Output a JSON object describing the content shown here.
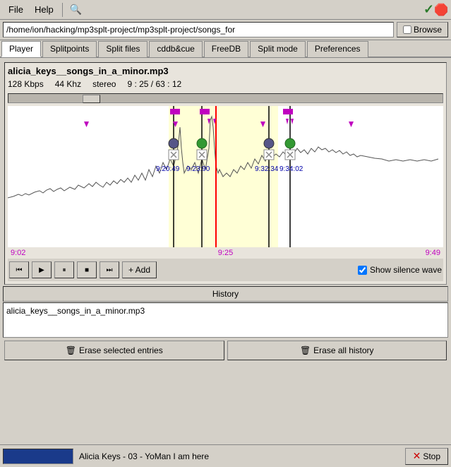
{
  "menubar": {
    "file": "File",
    "help": "Help",
    "search_icon": "🔍",
    "check_icon": "✓",
    "stop_icon": "🛑"
  },
  "pathbar": {
    "path": "/home/ion/hacking/mp3splt-project/mp3splt-project/songs_for",
    "browse_label": "Browse"
  },
  "tabs": [
    {
      "id": "player",
      "label": "Player",
      "active": true
    },
    {
      "id": "splitpoints",
      "label": "Splitpoints"
    },
    {
      "id": "split-files",
      "label": "Split files"
    },
    {
      "id": "cddb",
      "label": "cddb&cue"
    },
    {
      "id": "freedb",
      "label": "FreeDB"
    },
    {
      "id": "split-mode",
      "label": "Split mode"
    },
    {
      "id": "preferences",
      "label": "Preferences"
    }
  ],
  "player": {
    "filename": "alicia_keys__songs_in_a_minor.mp3",
    "bitrate": "128 Kbps",
    "sample_rate": "44 Khz",
    "channels": "stereo",
    "time_display": "9 : 25 / 63 : 12"
  },
  "waveform": {
    "time_start": "9:02",
    "time_mid": "9:25",
    "time_end": "9:49",
    "marker_times": [
      "9:20:49",
      "9:23:90",
      "9:32:34",
      "9:34:02"
    ],
    "playback_time": "9:25"
  },
  "transport": {
    "rewind_label": "⏮",
    "play_label": "▶",
    "pause_label": "⏸",
    "stop_label": "■",
    "forward_label": "⏭",
    "add_label": "+ Add",
    "show_silence_label": "Show silence wave"
  },
  "history": {
    "title": "History",
    "entry": "alicia_keys__songs_in_a_minor.mp3",
    "erase_selected_label": "Erase selected entries",
    "erase_all_label": "Erase all history"
  },
  "statusbar": {
    "track_label": "Alicia Keys - 03 - YoMan I am here",
    "stop_label": "Stop"
  }
}
